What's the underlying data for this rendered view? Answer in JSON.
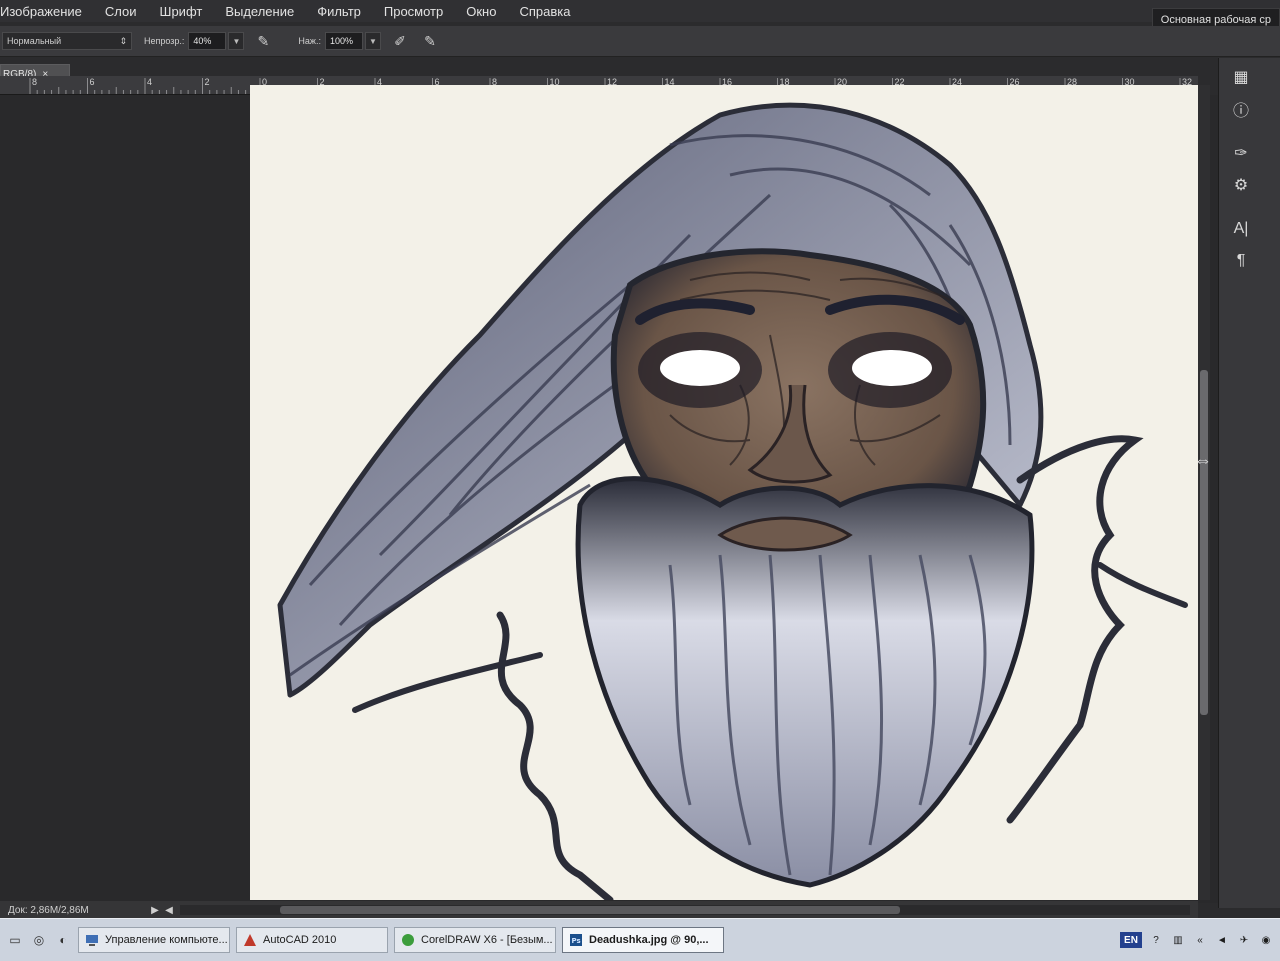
{
  "menu": [
    "Изображение",
    "Слои",
    "Шрифт",
    "Выделение",
    "Фильтр",
    "Просмотр",
    "Окно",
    "Справка"
  ],
  "workspace": "Основная рабочая ср",
  "options": {
    "blend_mode": "Нормальный",
    "opacity_label": "Непрозр.:",
    "opacity_value": "40%",
    "pressure_label": "Наж.:",
    "pressure_value": "100%"
  },
  "doc_tab": "RGB/8)",
  "ruler_labels": [
    "8",
    "6",
    "4",
    "2",
    "0",
    "2",
    "4",
    "6",
    "8",
    "10",
    "12",
    "14",
    "16",
    "18",
    "20",
    "22",
    "24",
    "26",
    "28",
    "30",
    "32"
  ],
  "status": {
    "doc_size": "Док: 2,86M/2,86M"
  },
  "taskbar": {
    "items": [
      {
        "label": "Управление компьюте...",
        "icon": "computer-management-icon"
      },
      {
        "label": "AutoCAD 2010",
        "icon": "autocad-icon"
      },
      {
        "label": "CorelDRAW X6 - [Безым...",
        "icon": "coreldraw-icon"
      },
      {
        "label": "Deadushka.jpg @ 90,...",
        "icon": "photoshop-icon"
      }
    ],
    "tray": {
      "lang": "EN"
    }
  },
  "canvas": {
    "artwork": "old-man-portrait",
    "colors": {
      "paper": "#f3f1e8",
      "ink": "#2b2d38",
      "hair_light": "#aeb2c6",
      "skin": "#7c6656"
    }
  }
}
